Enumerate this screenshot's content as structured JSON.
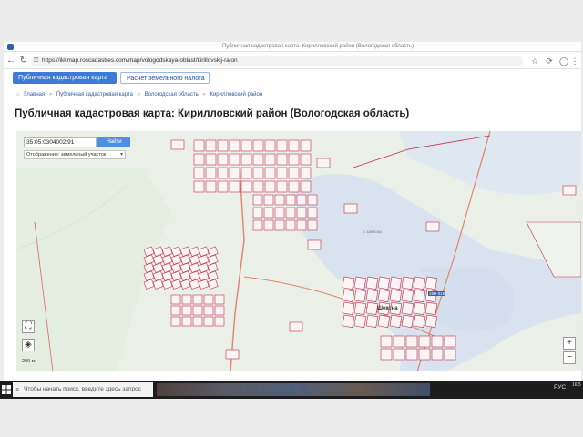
{
  "browser": {
    "window_title": "Публичная кадастровая карта: Кирилловский район (Вологодская область)",
    "url": "https://ikkmap.roscadastres.com/map/vologodskaya-oblast/kirillovskij-rajon",
    "back_glyph": "←",
    "forward_glyph": "→",
    "reload_glyph": "↻",
    "lock_glyph": "🔒"
  },
  "tabs": [
    {
      "label": "Публичная кадастровая карта",
      "active": true
    },
    {
      "label": "Расчет земельного налога",
      "active": false
    }
  ],
  "breadcrumb": [
    "Главная",
    "Публичная кадастровая карта",
    "Вологодская область",
    "Кирилловский район"
  ],
  "breadcrumb_separator": "»",
  "page_title": "Публичная кадастровая карта: Кирилловский район (Вологодская область)",
  "map": {
    "search_value": "35:05:0304002:91",
    "find_button": "Найти",
    "type_select_value": "Отображение: земельный участок",
    "type_select_chevron": "▾",
    "zoom_in": "+",
    "zoom_out": "−",
    "fullscreen_glyph": "⛶",
    "layers_glyph": "◈",
    "scale_label": "200 м",
    "place_label": "Шексна",
    "road_label": "19Н-016",
    "lake_label": "р. Шексна"
  },
  "taskbar": {
    "search_placeholder": "Чтобы начать поиск, введите здесь запрос",
    "search_icon_glyph": "⌕",
    "language": "РУС",
    "time": "16:5"
  },
  "colors": {
    "accent": "#3d7ad9",
    "parcel_outline": "#c0304a",
    "water": "#d9e3ef",
    "road": "#e3826a"
  }
}
